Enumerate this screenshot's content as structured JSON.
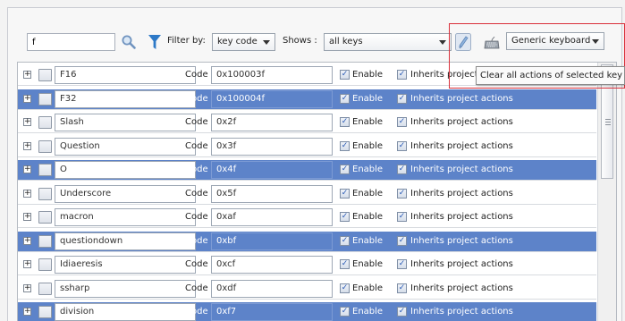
{
  "toolbar": {
    "filter_value": "f",
    "filter_by_label": "Filter by:",
    "filter_by_value": "key code",
    "shows_label": "Shows :",
    "shows_value": "all keys",
    "keyboard_value": "Generic keyboard",
    "tooltip": "Clear all actions of selected key",
    "icons": [
      "search-icon",
      "funnel-icon",
      "clear-actions-icon",
      "keyboard-icon"
    ]
  },
  "annotation_color": "#d9303a",
  "selected_row_color": "#5d83c9",
  "labels": {
    "code": "Code",
    "enable": "Enable",
    "inherits": "Inherits project actions"
  },
  "rows": [
    {
      "name": "F16",
      "code": "0x100003f",
      "selected": false
    },
    {
      "name": "F32",
      "code": "0x100004f",
      "selected": true
    },
    {
      "name": "Slash",
      "code": "0x2f",
      "selected": false
    },
    {
      "name": "Question",
      "code": "0x3f",
      "selected": false
    },
    {
      "name": "O",
      "code": "0x4f",
      "selected": true
    },
    {
      "name": "Underscore",
      "code": "0x5f",
      "selected": false
    },
    {
      "name": "macron",
      "code": "0xaf",
      "selected": false
    },
    {
      "name": "questiondown",
      "code": "0xbf",
      "selected": true
    },
    {
      "name": "Idiaeresis",
      "code": "0xcf",
      "selected": false
    },
    {
      "name": "ssharp",
      "code": "0xdf",
      "selected": false
    },
    {
      "name": "division",
      "code": "0xf7",
      "selected": true
    }
  ]
}
